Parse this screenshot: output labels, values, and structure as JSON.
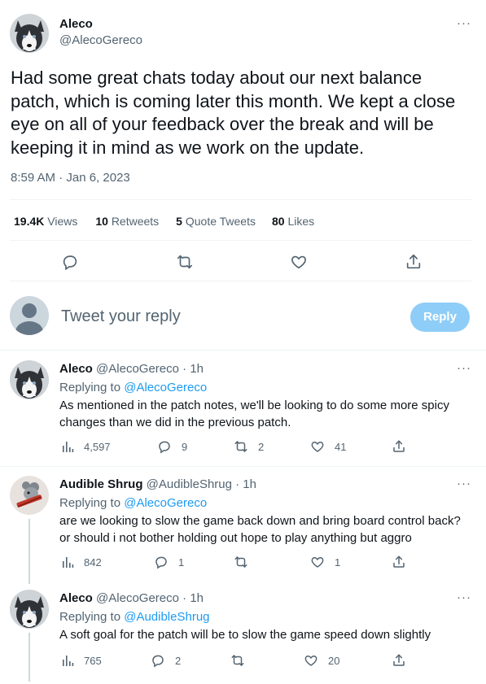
{
  "main_tweet": {
    "author_name": "Aleco",
    "author_handle": "@AlecoGereco",
    "text": "Had some great chats today about our next balance patch, which is coming later this month. We kept a close eye on all of your feedback over the break and will be keeping it in mind as we work on the update.",
    "timestamp": "8:59 AM · Jan 6, 2023",
    "stats": {
      "views_count": "19.4K",
      "views_label": "Views",
      "retweets_count": "10",
      "retweets_label": "Retweets",
      "quotes_count": "5",
      "quotes_label": "Quote Tweets",
      "likes_count": "80",
      "likes_label": "Likes"
    }
  },
  "reply_box": {
    "placeholder": "Tweet your reply",
    "button_label": "Reply"
  },
  "replies": [
    {
      "author_name": "Aleco",
      "author_handle": "@AlecoGereco",
      "time": "· 1h",
      "replying_prefix": "Replying to ",
      "replying_to": "@AlecoGereco",
      "text": "As mentioned in the patch notes, we'll be looking to do some more spicy changes than we did in the previous patch.",
      "views": "4,597",
      "replies": "9",
      "retweets": "2",
      "likes": "41"
    },
    {
      "author_name": "Audible Shrug",
      "author_handle": "@AudibleShrug",
      "time": "· 1h",
      "replying_prefix": "Replying to ",
      "replying_to": "@AlecoGereco",
      "text": "are we looking to slow the game back down and bring board control back? or should i not bother holding out hope to play anything but aggro",
      "views": "842",
      "replies": "1",
      "retweets": "",
      "likes": "1"
    },
    {
      "author_name": "Aleco",
      "author_handle": "@AlecoGereco",
      "time": "· 1h",
      "replying_prefix": "Replying to ",
      "replying_to": "@AudibleShrug",
      "text": "A soft goal for the patch will be to slow the game speed down slightly",
      "views": "765",
      "replies": "2",
      "retweets": "",
      "likes": "20"
    }
  ],
  "colors": {
    "accent": "#1d9bf0",
    "reply_button_disabled": "#8ecdf7",
    "muted": "#536471",
    "text": "#0f1419"
  }
}
